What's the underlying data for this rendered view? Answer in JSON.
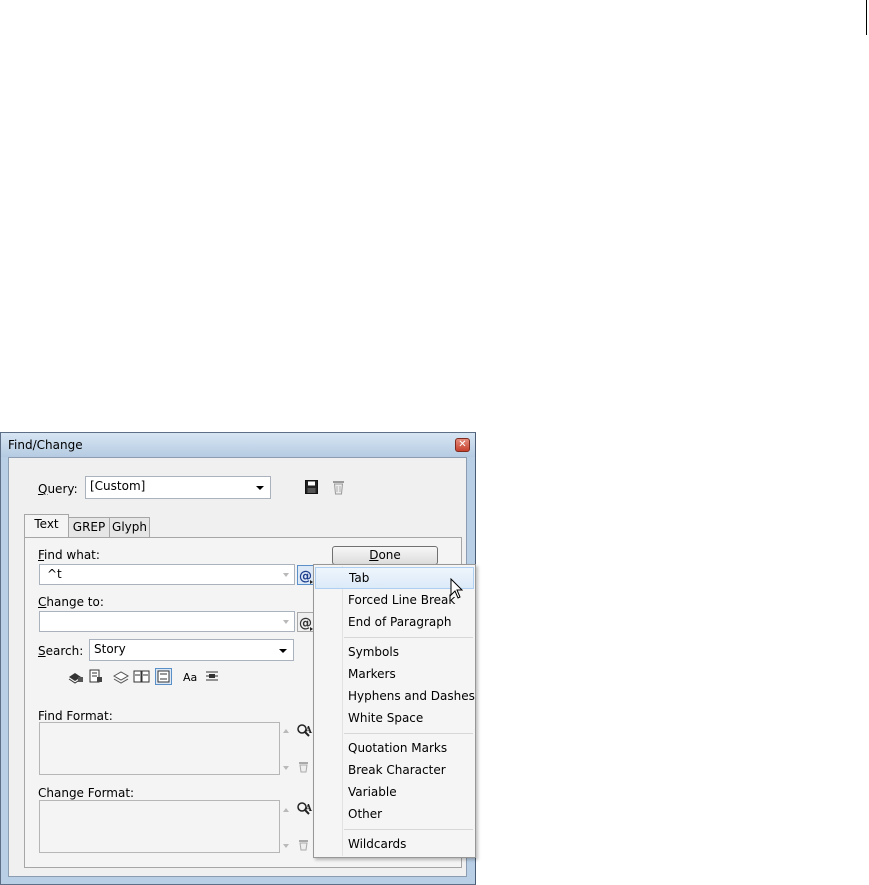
{
  "window": {
    "title": "Find/Change"
  },
  "query": {
    "label_ul": "Q",
    "label_rest": "uery:",
    "value": "[Custom]"
  },
  "tabs": [
    {
      "label": "Text",
      "active": true
    },
    {
      "label": "GREP",
      "active": false
    },
    {
      "label": "Glyph",
      "active": false
    }
  ],
  "find_what": {
    "label_ul": "F",
    "label_rest": "ind what:",
    "value": "^t"
  },
  "change_to": {
    "label_ul": "C",
    "label_rest": "hange to:",
    "value": ""
  },
  "search": {
    "label_ul": "S",
    "label_rest": "earch:",
    "value": "Story"
  },
  "options_text": {
    "case": "Aa"
  },
  "find_format": {
    "label": "Find Format:"
  },
  "change_format": {
    "label": "Change Format:"
  },
  "done_button": {
    "label_ul": "D",
    "label_rest": "one"
  },
  "special_menu": {
    "items": [
      "Tab",
      "Forced Line Break",
      "End of Paragraph",
      "Symbols",
      "Markers",
      "Hyphens and Dashes",
      "White Space",
      "Quotation Marks",
      "Break Character",
      "Variable",
      "Other",
      "Wildcards"
    ],
    "highlighted": "Tab"
  },
  "colors": {
    "titlebar": "#b8cfe6",
    "close_button": "#c6412d",
    "menu_highlight": "#dceaf8"
  }
}
